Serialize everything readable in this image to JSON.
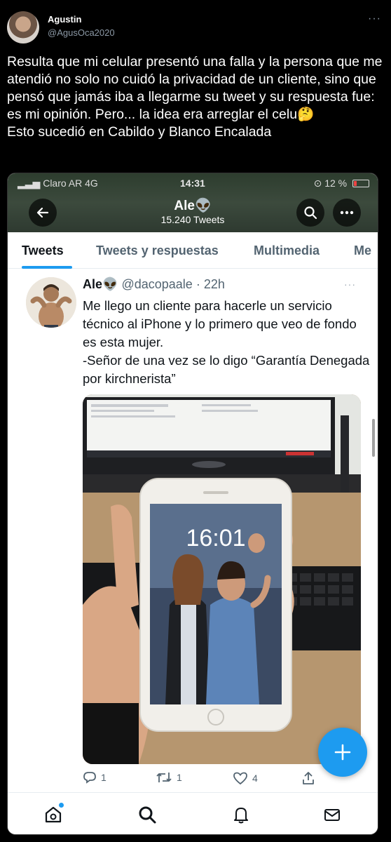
{
  "outer_tweet": {
    "author_name": "Agustin",
    "author_handle": "@AgusOca2020",
    "text": "Resulta que mi celular presentó una falla y la persona que me atendió no solo no cuidó la privacidad de un cliente, sino que pensó que jamás iba a llegarme su tweet y su respuesta fue: es mi opinión. Pero... la idea era arreglar el celu🤔\nEsto sucedió en Cabildo y Blanco Encalada",
    "more_icon": "more-dots-icon"
  },
  "screenshot": {
    "status_bar": {
      "carrier": "Claro AR",
      "network": "4G",
      "time": "14:31",
      "battery": "12 %"
    },
    "profile": {
      "name": "Ale👽",
      "tweet_count": "15.240 Tweets"
    },
    "tabs": [
      {
        "label": "Tweets",
        "active": true
      },
      {
        "label": "Tweets y respuestas",
        "active": false
      },
      {
        "label": "Multimedia",
        "active": false
      },
      {
        "label": "Me",
        "active": false
      }
    ],
    "inner_tweet": {
      "name": "Ale👽",
      "handle": "@dacopaale",
      "time": "· 22h",
      "text": "Me llego un cliente para hacerle un servicio técnico al iPhone y lo primero que veo de fondo es esta mujer.\n-Señor de una vez se lo digo “Garantía Denegada por kirchnerista”",
      "phone_clock": "16:01"
    },
    "actions": {
      "replies": "1",
      "retweets": "1",
      "likes": "4"
    },
    "accent_color": "#1d9bf0"
  }
}
